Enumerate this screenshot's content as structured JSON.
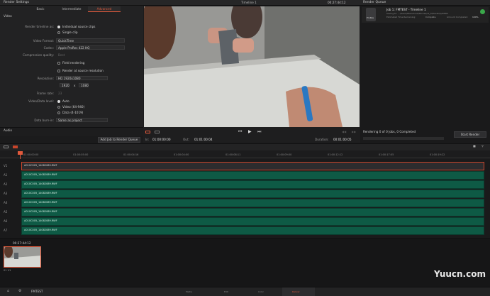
{
  "render_settings": {
    "title": "Render Settings",
    "tabs": [
      "Basic",
      "Intermediate",
      "Advanced"
    ],
    "active_tab": "Advanced",
    "section_video": "Video",
    "render_timeline_as_label": "Render timeline as:",
    "render_option_individual": "Individual source clips",
    "render_option_single": "Single clip",
    "video_format_label": "Video Format:",
    "video_format_value": "QuickTime",
    "codec_label": "Codec:",
    "codec_value": "Apple ProRes 422 HQ",
    "compression_label": "Compression quality:",
    "compression_value": "Best",
    "field_rendering": "Field rendering",
    "render_at_source": "Render at source resolution",
    "resolution_label": "Resolution:",
    "resolution_value": "HD 1920x1080",
    "res_width": "1920",
    "res_x": "x",
    "res_height": "1080",
    "frame_rate_label": "Frame rate:",
    "frame_rate_value": "23",
    "data_levels_label": "Video/Data level:",
    "data_level_auto": "Auto",
    "data_level_video": "Video (64-940)",
    "data_level_full": "Data (4-1019)",
    "data_burnin_label": "Data burn-in:",
    "data_burnin_value": "Same as project",
    "section_audio": "Audio",
    "add_job_button": "Add Job to Render Queue"
  },
  "viewer": {
    "title": "Timeline 1",
    "timecode_top": "00:27:44:12",
    "in_label": "In:",
    "in_value": "01:00:00:00",
    "out_label": "Out:",
    "out_value": "01:01:00:04",
    "duration_label": "Duration:",
    "duration_value": "00:01:00:05"
  },
  "render_queue": {
    "title": "Render Queue",
    "job_title": "Job 1: FMTEST - Timeline 1",
    "job_saving": "Saving to: .../Users/Macintosh/Movies/ut_fr/Desktop/IMMO",
    "job_time": "Estimated Time Remaining:",
    "job_time_value": "Complete",
    "job_amount": "Amount Completed:",
    "job_amount_value": "100%",
    "codec_badge": "ProRes",
    "status": "Rendering 0 of 0 Jobs, 0 Completed",
    "start_button": "Start Render"
  },
  "timeline": {
    "ruler": [
      "01:00:00:00",
      "01:00:05:00",
      "01:00:04:16",
      "01:00:04:00",
      "01:00:08:11",
      "01:00:09:00",
      "01:00:12:12",
      "01:00:17:05",
      "01:00:19:22"
    ],
    "tracks": [
      {
        "label": "V1",
        "clip": "A010C005_14082089.RWF"
      },
      {
        "label": "A1",
        "clip": "A010C005_14082089.RWF"
      },
      {
        "label": "A2",
        "clip": "A010C005_14082089.RWF"
      },
      {
        "label": "A3",
        "clip": "A010C005_14082089.RWF"
      },
      {
        "label": "A4",
        "clip": "A010C005_14082089.RWF"
      },
      {
        "label": "A5",
        "clip": "A010C005_14082089.RWF"
      },
      {
        "label": "A6",
        "clip": "A010C005_14082089.RWF"
      },
      {
        "label": "A7",
        "clip": "A010C005_14082089.RWF"
      }
    ]
  },
  "media": {
    "clip_timecode": "00:27:44:12",
    "clip_label": "01  V1"
  },
  "footer": {
    "project_name": "FMTEST",
    "pages": [
      "Media",
      "Edit",
      "Color",
      "Deliver"
    ]
  },
  "watermark": "Yuucn.com"
}
